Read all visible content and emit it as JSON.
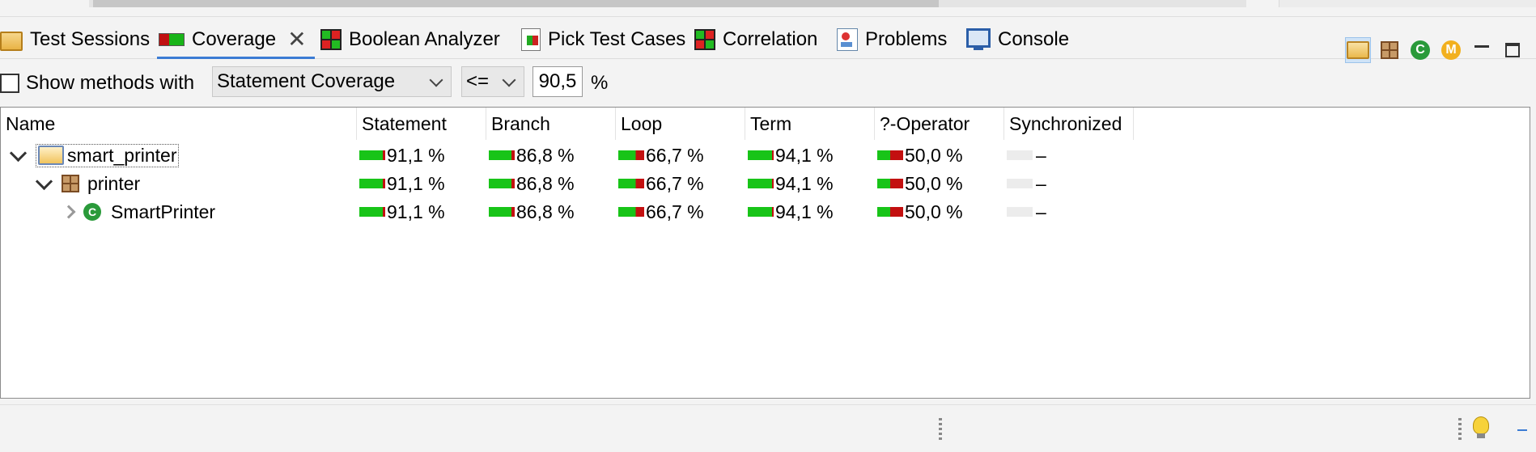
{
  "tabs": [
    {
      "label": "Test Sessions",
      "icon": "test-sessions-icon"
    },
    {
      "label": "Coverage",
      "icon": "coverage-icon",
      "active": true
    },
    {
      "label": "Boolean Analyzer",
      "icon": "boolean-analyzer-icon"
    },
    {
      "label": "Pick Test Cases",
      "icon": "pick-test-cases-icon"
    },
    {
      "label": "Correlation",
      "icon": "correlation-icon"
    },
    {
      "label": "Problems",
      "icon": "problems-icon"
    },
    {
      "label": "Console",
      "icon": "console-icon"
    }
  ],
  "toolbar": {
    "class_icon_letter": "C",
    "method_icon_letter": "M"
  },
  "filter": {
    "checkbox_label": "Show methods with",
    "metric": "Statement Coverage",
    "operator": "<=",
    "threshold": "90,5",
    "unit": "%"
  },
  "columns": [
    "Name",
    "Statement",
    "Branch",
    "Loop",
    "Term",
    "?-Operator",
    "Synchronized"
  ],
  "rows": [
    {
      "name": "smart_printer",
      "type": "project",
      "level": 0,
      "expanded": true,
      "selected": true,
      "statement": "91,1 %",
      "branch": "86,8 %",
      "loop": "66,7 %",
      "term": "94,1 %",
      "operator": "50,0 %",
      "synchronized": "–"
    },
    {
      "name": "printer",
      "type": "package",
      "level": 1,
      "expanded": true,
      "statement": "91,1 %",
      "branch": "86,8 %",
      "loop": "66,7 %",
      "term": "94,1 %",
      "operator": "50,0 %",
      "synchronized": "–"
    },
    {
      "name": "SmartPrinter",
      "type": "class",
      "level": 2,
      "expanded": false,
      "class_letter": "C",
      "statement": "91,1 %",
      "branch": "86,8 %",
      "loop": "66,7 %",
      "term": "94,1 %",
      "operator": "50,0 %",
      "synchronized": "–"
    }
  ],
  "coverage_fractions": {
    "statement": 0.911,
    "branch": 0.868,
    "loop": 0.667,
    "term": 0.941,
    "operator": 0.5
  },
  "colors": {
    "covered": "#18c418",
    "uncovered": "#c31010",
    "active_tab_underline": "#3b7bd4"
  }
}
